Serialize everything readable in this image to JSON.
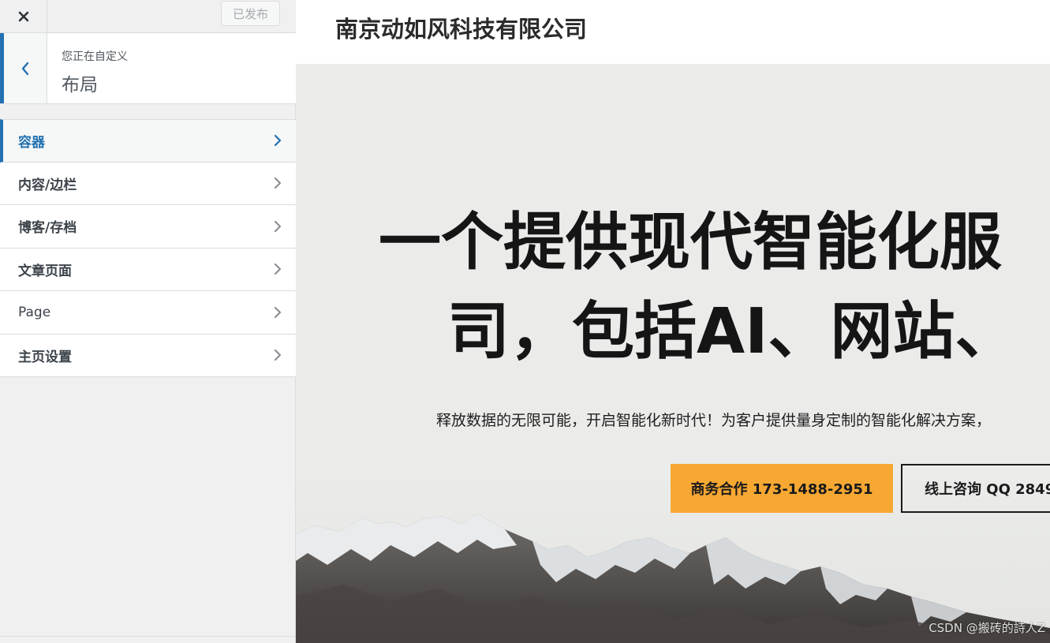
{
  "customizer": {
    "publish_label": "已发布",
    "section": {
      "context_label": "您正在自定义",
      "title": "布局"
    },
    "menu": [
      {
        "label": "容器",
        "active": true
      },
      {
        "label": "内容/边栏"
      },
      {
        "label": "博客/存档"
      },
      {
        "label": "文章页面"
      },
      {
        "label": "Page"
      },
      {
        "label": "主页设置"
      }
    ],
    "accent_color": "#2271b1"
  },
  "preview": {
    "site_title": "南京动如风科技有限公司",
    "hero": {
      "heading_line1": "一个提供现代智能化服",
      "heading_line2": "司，包括AI、网站、",
      "subtitle": "释放数据的无限可能，开启智能化新时代！为客户提供量身定制的智能化解决方案，",
      "primary_button": "商务合作 173-1488-2951",
      "secondary_button": "线上咨询 QQ 2849",
      "primary_color": "#f7a833"
    },
    "watermark": "CSDN @搬砖的詩人Z"
  }
}
